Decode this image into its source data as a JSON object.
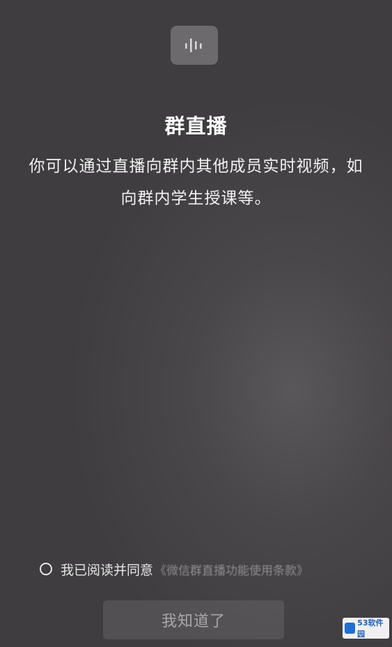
{
  "header": {
    "icon": "live-audio-wave-icon",
    "title": "群直播"
  },
  "description": {
    "line1": "你可以通过直播向群内其他成员实时视频，如",
    "line2": "向群内学生授课等。"
  },
  "agreement": {
    "checked": false,
    "label": "我已阅读并同意",
    "terms_link": "《微信群直播功能使用条款》"
  },
  "confirm_button": {
    "label": "我知道了"
  },
  "watermark": {
    "text": "53软件园",
    "logo": "53-logo-icon"
  },
  "colors": {
    "background": "#454345",
    "title": "#ffffff",
    "link_muted": "#8e8c8e",
    "button_text": "#a9a7a9"
  }
}
